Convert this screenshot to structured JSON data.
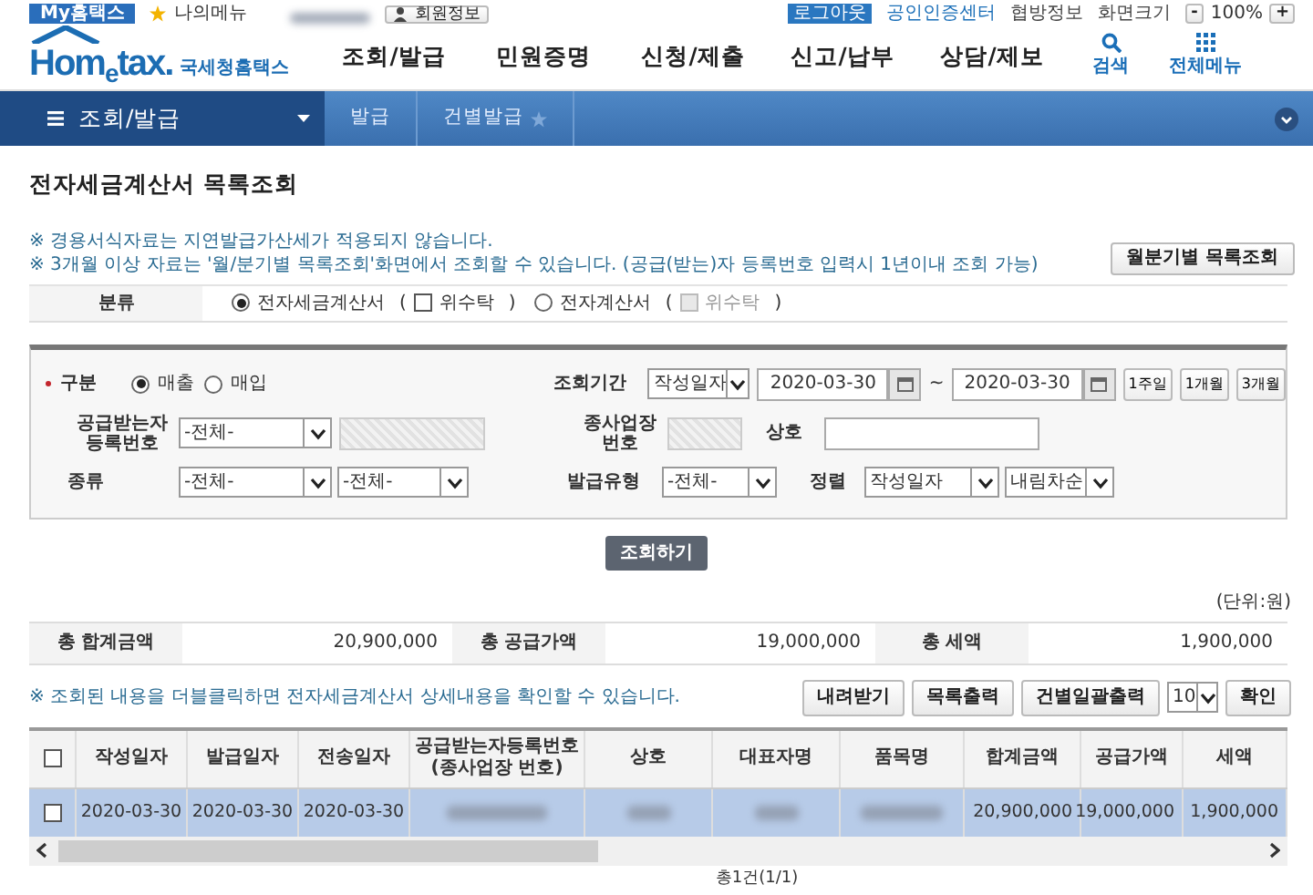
{
  "top_bar": {
    "my": "My홈택스",
    "my_menu": "나의메뉴",
    "member": "회원정보",
    "logout": "로그아웃",
    "links": [
      "공인인증센터",
      "협방정보",
      "화면크기"
    ],
    "zoom_minus": "-",
    "zoom": "100%",
    "zoom_plus": "+"
  },
  "header": {
    "logo_start": "Hom",
    "logo_e": "e",
    "logo_end": "tax.",
    "logo_korean": "국세청홈택스",
    "menu": [
      "조회/발급",
      "민원증명",
      "신청/제출",
      "신고/납부",
      "상담/제보"
    ],
    "search": "검색",
    "all_menu": "전체메뉴"
  },
  "breadcrumb": {
    "section": "조회/발급",
    "crumbs": [
      "발급",
      "건별발급"
    ]
  },
  "page_title": "전자세금계산서 목록조회",
  "notes": [
    "※ 경용서식자료는 지연발급가산세가 적용되지 않습니다.",
    "※ 3개월 이상 자료는 '월/분기별 목록조회'화면에서 조회할 수 있습니다. (공급(받는)자 등록번호 입력시 1년이내 조회 가능)"
  ],
  "period_button": "월분기별 목록조회",
  "category": {
    "label": "분류",
    "options": [
      {
        "label": "전자세금계산서",
        "selected": true,
        "open": "(",
        "consign": "위수탁",
        "checked": false,
        "disabled": false,
        "close": ")"
      },
      {
        "label": "전자계산서",
        "selected": false,
        "open": "(",
        "consign": "위수탁",
        "checked": false,
        "disabled": true,
        "close": ")"
      }
    ]
  },
  "form": {
    "type": {
      "label": "구분",
      "required": true,
      "options": [
        {
          "label": "매출",
          "selected": true
        },
        {
          "label": "매입",
          "selected": false
        }
      ]
    },
    "supplier": {
      "label": "공급받는자 등록번호",
      "select": "-전체-"
    },
    "kind": {
      "label": "종류",
      "selects": [
        "-전체-",
        "-전체-"
      ]
    },
    "period": {
      "label": "조회기간",
      "date_type": "작성일자",
      "from": "2020-03-30",
      "tilde": "~",
      "to": "2020-03-30",
      "quick": [
        "1주일",
        "1개월",
        "3개월"
      ]
    },
    "branch": {
      "label": "종사업장 번호",
      "company_label": "상호"
    },
    "issue_type": {
      "label": "발급유형",
      "select": "-전체-"
    },
    "sort": {
      "label": "정렬",
      "field": "작성일자",
      "order": "내림차순"
    }
  },
  "search_button": "조회하기",
  "unit": "(단위:원)",
  "totals": [
    {
      "label": "총 합계금액",
      "value": "20,900,000"
    },
    {
      "label": "총 공급가액",
      "value": "19,000,000"
    },
    {
      "label": "총 세액",
      "value": "1,900,000"
    }
  ],
  "list_note": "※ 조회된 내용을 더블클릭하면 전자세금계산서 상세내용을 확인할 수 있습니다.",
  "actions": [
    "내려받기",
    "목록출력",
    "건별일괄출력"
  ],
  "page_size": "10",
  "confirm": "확인",
  "table": {
    "all_checked": false,
    "columns": [
      {
        "label": "작성일자"
      },
      {
        "label": "발급일자"
      },
      {
        "label": "전송일자"
      },
      {
        "label": "공급받는자등록번호",
        "sublabel": "(종사업장 번호)"
      },
      {
        "label": "상호"
      },
      {
        "label": "대표자명"
      },
      {
        "label": "품목명"
      },
      {
        "label": "합계금액"
      },
      {
        "label": "공급가액"
      },
      {
        "label": "세액"
      }
    ],
    "rows": [
      {
        "selected": true,
        "checked": false,
        "cells": [
          {
            "kind": "text",
            "text": "2020-03-30"
          },
          {
            "kind": "text",
            "text": "2020-03-30"
          },
          {
            "kind": "text",
            "text": "2020-03-30"
          },
          {
            "kind": "blurred"
          },
          {
            "kind": "blurred"
          },
          {
            "kind": "blurred"
          },
          {
            "kind": "blurred"
          },
          {
            "kind": "amount",
            "text": "20,900,000"
          },
          {
            "kind": "amount",
            "text": "19,000,000"
          },
          {
            "kind": "amount",
            "text": "1,900,000"
          }
        ]
      }
    ]
  },
  "pager_summary": "총1건(1/1)"
}
